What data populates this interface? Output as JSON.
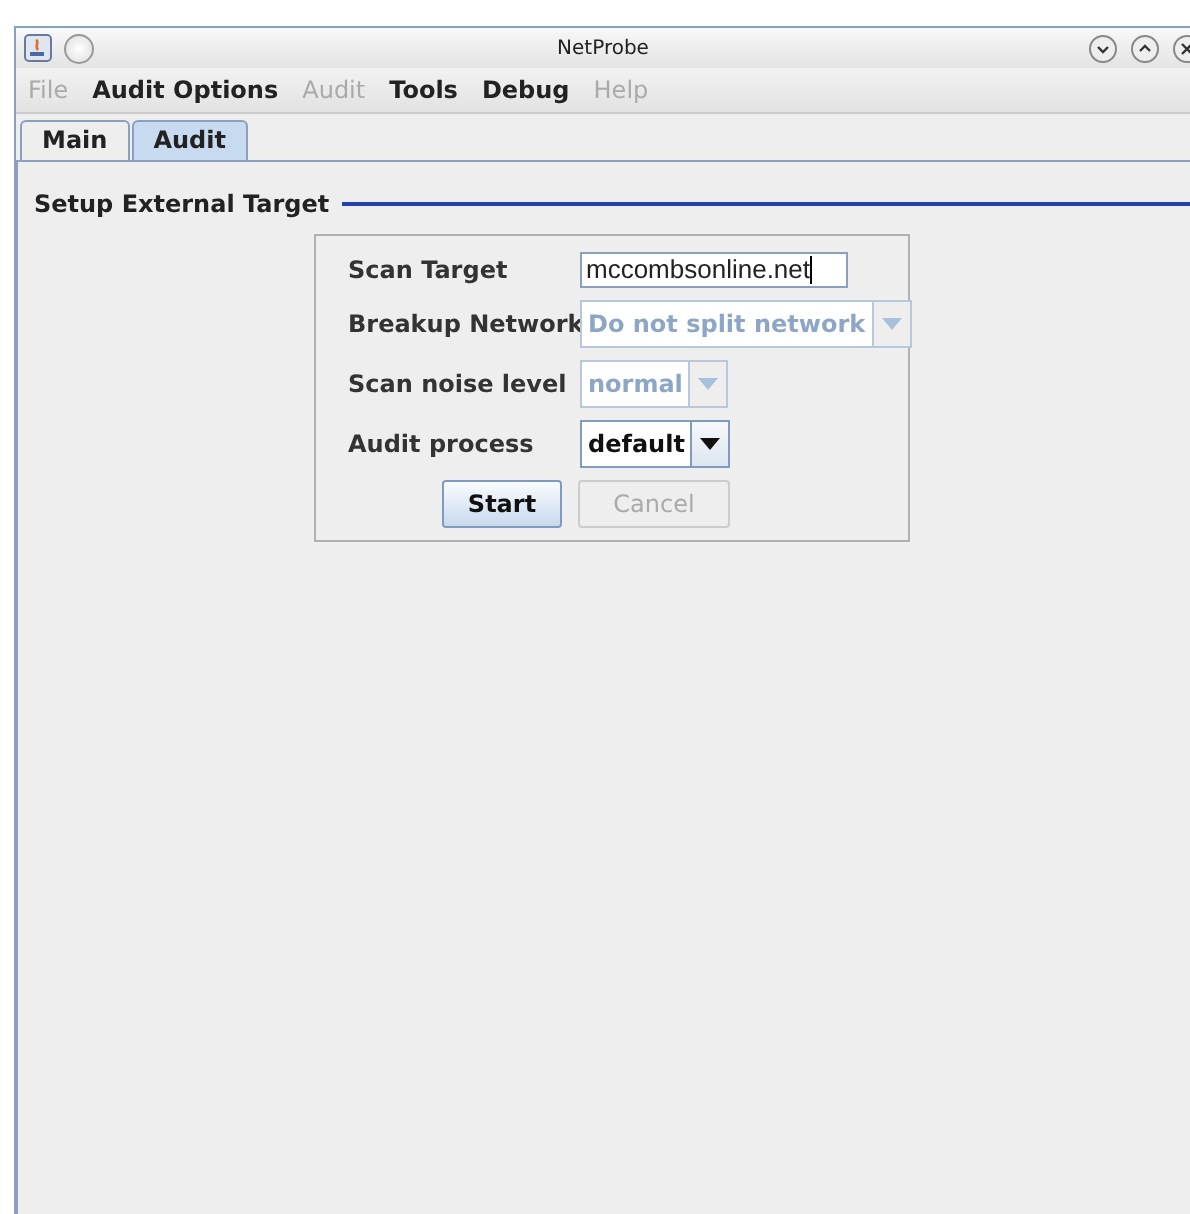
{
  "window": {
    "title": "NetProbe"
  },
  "menu": [
    {
      "label": "File",
      "disabled": true
    },
    {
      "label": "Audit Options",
      "disabled": false
    },
    {
      "label": "Audit",
      "disabled": true
    },
    {
      "label": "Tools",
      "disabled": false
    },
    {
      "label": "Debug",
      "disabled": false
    },
    {
      "label": "Help",
      "disabled": true
    }
  ],
  "tabs": [
    {
      "label": "Main",
      "selected": false
    },
    {
      "label": "Audit",
      "selected": true
    }
  ],
  "section": {
    "title": "Setup External Target"
  },
  "form": [
    {
      "kind": "text",
      "label": "Scan Target",
      "value": "mccombsonline.net",
      "disabled": false
    },
    {
      "kind": "combo",
      "label": "Breakup Network",
      "value": "Do not split network",
      "disabled": true
    },
    {
      "kind": "combo",
      "label": "Scan noise level",
      "value": "normal",
      "disabled": true
    },
    {
      "kind": "combo",
      "label": "Audit process",
      "value": "default",
      "disabled": false
    }
  ],
  "buttons": [
    {
      "label": "Start",
      "disabled": false
    },
    {
      "label": "Cancel",
      "disabled": true
    }
  ]
}
